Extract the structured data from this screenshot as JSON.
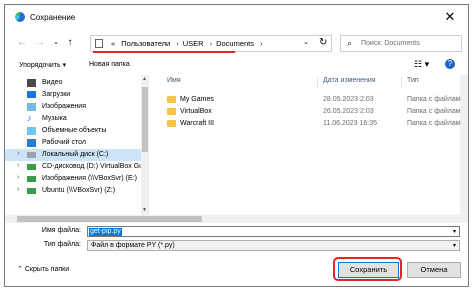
{
  "window": {
    "title": "Сохранение",
    "close_glyph": "✕"
  },
  "nav": {
    "back": "←",
    "forward": "→",
    "recent": "⌄",
    "up": "↑"
  },
  "address": {
    "prefix": "«",
    "crumbs": [
      "Пользователи",
      "USER",
      "Documents"
    ],
    "separator": "›",
    "dropdown": "⌄",
    "refresh": "↻"
  },
  "search": {
    "placeholder": "Поиск: Documents"
  },
  "toolbar": {
    "organize_label": "Упорядочить ▾",
    "new_folder_label": "Новая папка"
  },
  "sidebar": {
    "items": [
      {
        "label": "Видео",
        "icon": "video-icon"
      },
      {
        "label": "Загрузки",
        "icon": "downloads-icon"
      },
      {
        "label": "Изображения",
        "icon": "pictures-icon"
      },
      {
        "label": "Музыка",
        "icon": "music-icon"
      },
      {
        "label": "Объемные объекты",
        "icon": "3d-objects-icon"
      },
      {
        "label": "Рабочий стол",
        "icon": "desktop-icon"
      },
      {
        "label": "Локальный диск (C:)",
        "icon": "drive-icon"
      },
      {
        "label": "CD-дисковод (D:) VirtualBox Gu",
        "icon": "cd-drive-icon"
      },
      {
        "label": "Изображения (\\\\VBoxSvr) (E:)",
        "icon": "network-drive-icon"
      },
      {
        "label": "Ubuntu (\\\\VBoxSvr) (Z:)",
        "icon": "network-drive-icon"
      }
    ],
    "selected_index": 6
  },
  "files": {
    "columns": [
      "Имя",
      "Дата изменения",
      "Тип"
    ],
    "rows": [
      {
        "name": "My Games",
        "date": "28.05.2023 2:03",
        "type": "Папка с файлами"
      },
      {
        "name": "VirtualBox",
        "date": "26.05.2023 2:03",
        "type": "Папка с файлами"
      },
      {
        "name": "Warcraft III",
        "date": "11.06.2023 16:35",
        "type": "Папка с файлами"
      }
    ]
  },
  "form": {
    "filename_label": "Имя файла:",
    "filename_value": "get-pip.py",
    "filetype_label": "Тип файла:",
    "filetype_value": "Файл в формате PY (*.py)"
  },
  "footer": {
    "hide_folders": "Скрыть папки",
    "save_label": "Сохранить",
    "cancel_label": "Отмена"
  },
  "colors": {
    "highlight": "#e0242a",
    "selection": "#cce4f7",
    "accent": "#0078d7",
    "folder": "#f4c542"
  }
}
